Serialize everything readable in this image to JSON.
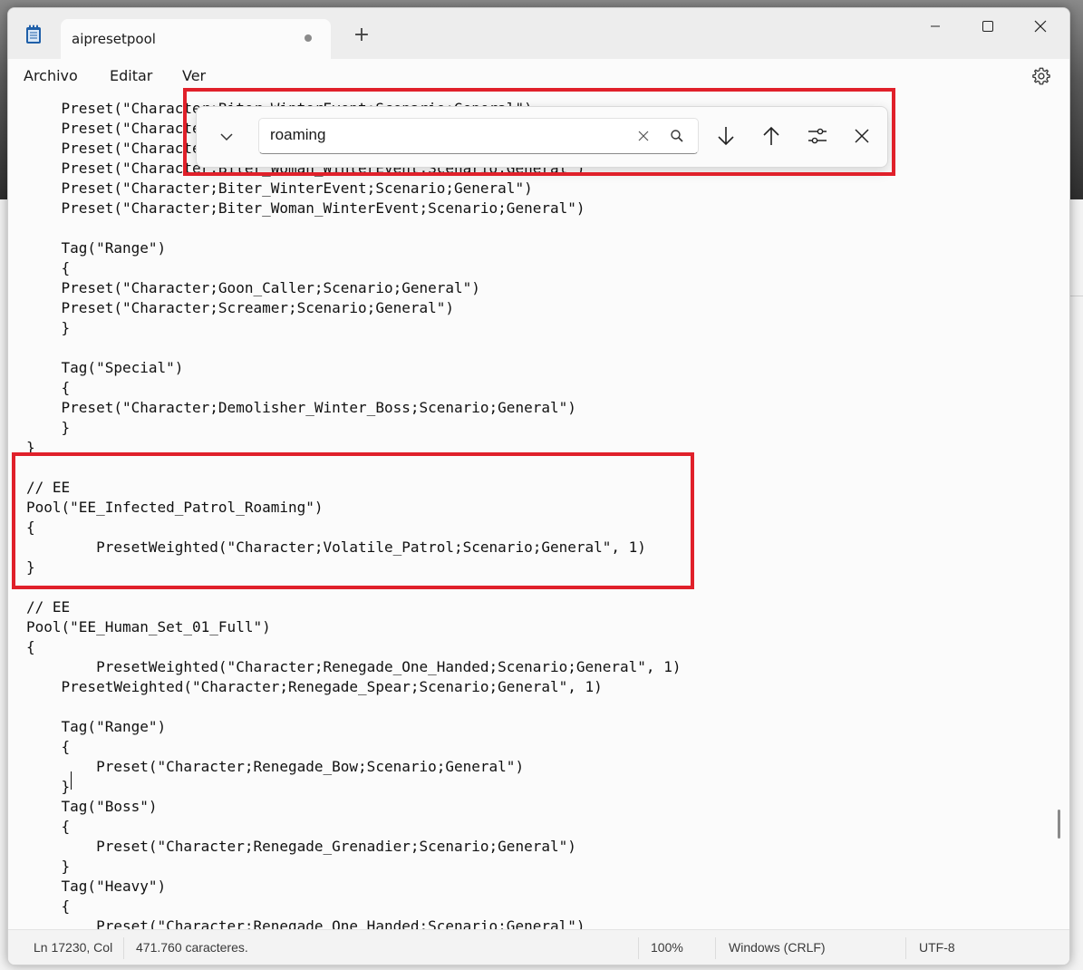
{
  "window": {
    "tab_title": "aipresetpool"
  },
  "menu": {
    "items": [
      "Archivo",
      "Editar",
      "Ver"
    ]
  },
  "find": {
    "query": "roaming"
  },
  "editor": {
    "lines": [
      "    Preset(\"Character;Biter_WinterEvent;Scenario;General\")",
      "    Preset(\"Character;Biter_Woman_WinterEvent;Scenario;General\")",
      "    Preset(\"Character;Biter_WinterEvent;Scenario;General\")",
      "    Preset(\"Character;Biter_Woman_WinterEvent;Scenario;General\")",
      "    Preset(\"Character;Biter_WinterEvent;Scenario;General\")",
      "    Preset(\"Character;Biter_Woman_WinterEvent;Scenario;General\")",
      "",
      "    Tag(\"Range\")",
      "    {",
      "    Preset(\"Character;Goon_Caller;Scenario;General\")",
      "    Preset(\"Character;Screamer;Scenario;General\")",
      "    }",
      "",
      "    Tag(\"Special\")",
      "    {",
      "    Preset(\"Character;Demolisher_Winter_Boss;Scenario;General\")",
      "    }",
      "}",
      "",
      "// EE",
      "Pool(\"EE_Infected_Patrol_Roaming\")",
      "{",
      "        PresetWeighted(\"Character;Volatile_Patrol;Scenario;General\", 1)",
      "}",
      "",
      "// EE",
      "Pool(\"EE_Human_Set_01_Full\")",
      "{",
      "        PresetWeighted(\"Character;Renegade_One_Handed;Scenario;General\", 1)",
      "    PresetWeighted(\"Character;Renegade_Spear;Scenario;General\", 1)",
      "",
      "    Tag(\"Range\")",
      "    {",
      "        Preset(\"Character;Renegade_Bow;Scenario;General\")",
      "    }",
      "    Tag(\"Boss\")",
      "    {",
      "        Preset(\"Character;Renegade_Grenadier;Scenario;General\")",
      "    }",
      "    Tag(\"Heavy\")",
      "    {",
      "        Preset(\"Character;Renegade_One_Handed;Scenario;General\")"
    ]
  },
  "status": {
    "position": "Ln 17230, Col",
    "chars": "471.760 caracteres.",
    "zoom": "100%",
    "eol": "Windows (CRLF)",
    "encoding": "UTF-8"
  }
}
